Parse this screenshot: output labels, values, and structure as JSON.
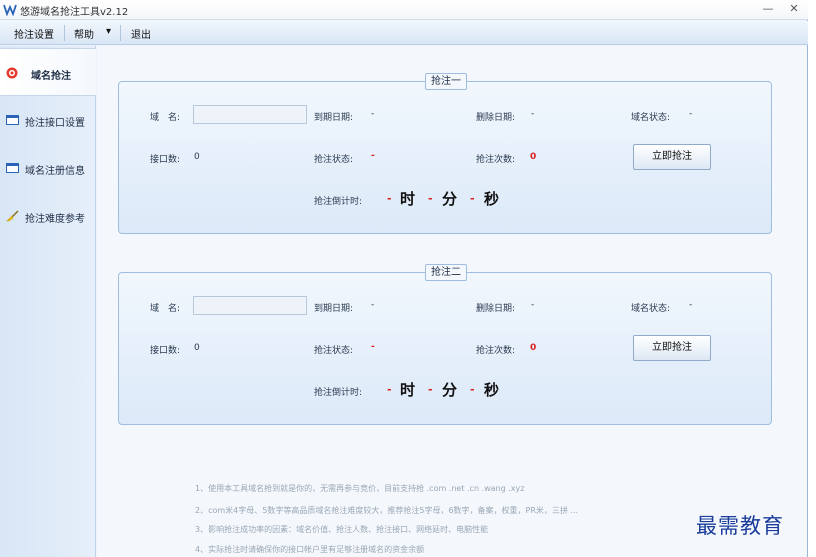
{
  "window": {
    "title": "悠游域名抢注工具v2.12",
    "minimize": "—",
    "close": "✕"
  },
  "menu": {
    "items": [
      {
        "label": "抢注设置"
      },
      {
        "label": "帮助"
      },
      {
        "label": "▾"
      },
      {
        "label": "退出"
      }
    ]
  },
  "sidebar": {
    "items": [
      {
        "label": "域名抢注"
      },
      {
        "label": "抢注接口设置"
      },
      {
        "label": "域名注册信息"
      },
      {
        "label": "抢注难度参考"
      }
    ]
  },
  "panels": [
    {
      "title": "抢注一",
      "domain_label": "域　名:",
      "domain_value": "",
      "expire_label": "到期日期:",
      "expire_value": "-",
      "delete_label": "删除日期:",
      "delete_value": "-",
      "status_label": "域名状态:",
      "status_value": "-",
      "ports_label": "接口数:",
      "ports_value": "0",
      "reg_status_label": "抢注状态:",
      "reg_status_value": "-",
      "attempts_label": "抢注次数:",
      "attempts_value": "0",
      "button": "立即抢注",
      "countdown_label": "抢注倒计时:",
      "hours": "时",
      "minutes": "分",
      "seconds": "秒",
      "dash": "-"
    },
    {
      "title": "抢注二",
      "domain_label": "域　名:",
      "domain_value": "",
      "expire_label": "到期日期:",
      "expire_value": "-",
      "delete_label": "删除日期:",
      "delete_value": "-",
      "status_label": "域名状态:",
      "status_value": "-",
      "ports_label": "接口数:",
      "ports_value": "0",
      "reg_status_label": "抢注状态:",
      "reg_status_value": "-",
      "attempts_label": "抢注次数:",
      "attempts_value": "0",
      "button": "立即抢注",
      "countdown_label": "抢注倒计时:",
      "hours": "时",
      "minutes": "分",
      "seconds": "秒",
      "dash": "-"
    }
  ],
  "notes": [
    "1、使用本工具域名抢到就是你的，无需再参与竞价，目前支持抢 .com .net .cn .wang .xyz",
    "2、com米4字母、5数字等高品质域名抢注难度较大，推荐抢注5字母，6数字，备案，权重，PR米，三拼 ...",
    "3、影响抢注成功率的因素：域名价值、抢注人数、抢注接口、网络延时、电脑性能",
    "4、实际抢注时请确保你的接口帐户里有足够注册域名的资金余额"
  ],
  "watermark": "最需教育",
  "colors": {
    "accent": "#d62020",
    "panel_border": "#9fbde0",
    "sidebar": "#d8e6f6"
  }
}
